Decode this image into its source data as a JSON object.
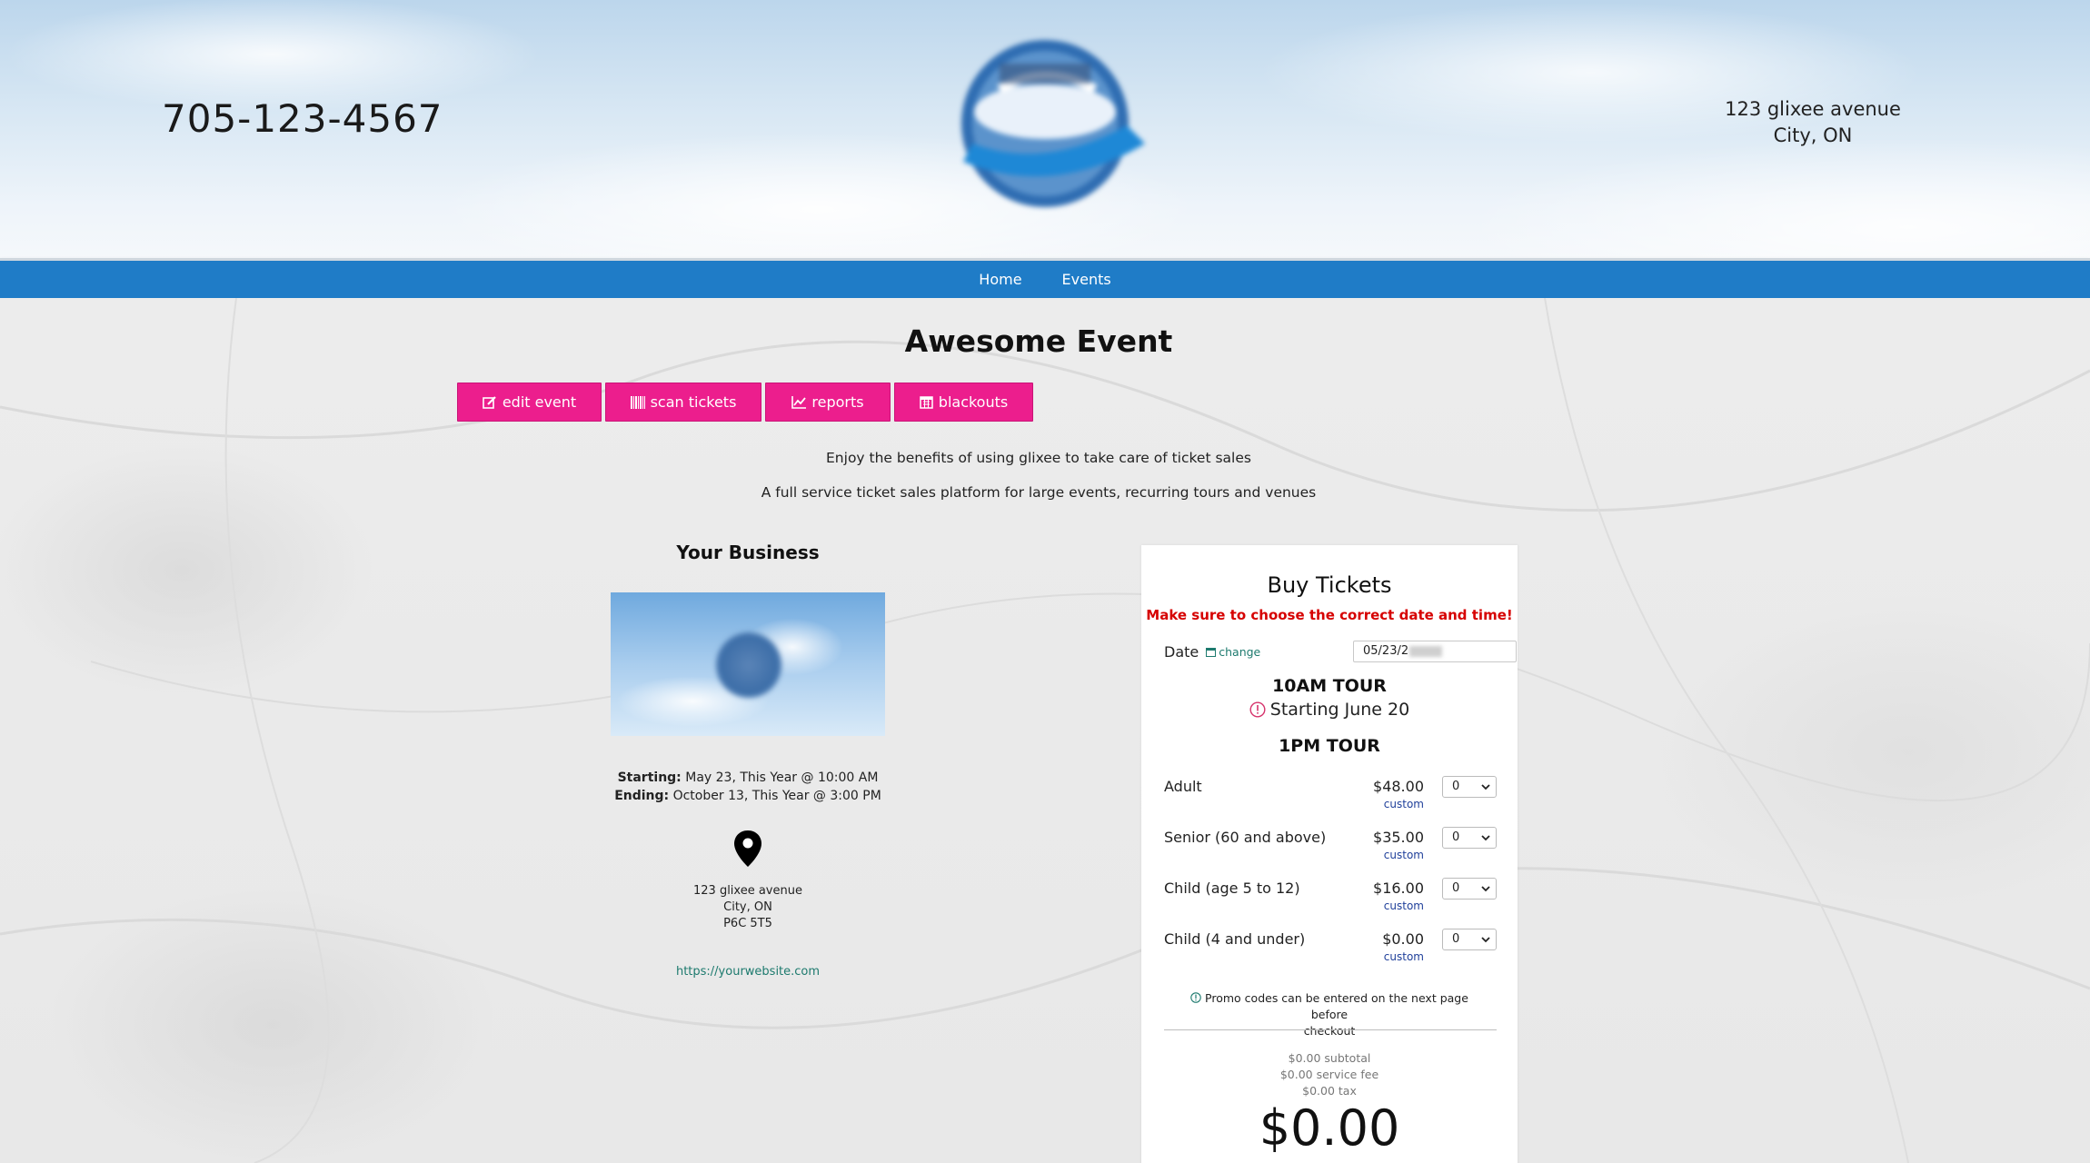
{
  "header": {
    "phone": "705-123-4567",
    "address_line1": "123 glixee avenue",
    "address_line2": "City, ON",
    "logo_icon": "company-logo"
  },
  "nav": {
    "items": [
      "Home",
      "Events"
    ]
  },
  "event": {
    "title": "Awesome Event",
    "buttons": [
      {
        "label": "edit event",
        "icon": "edit-icon"
      },
      {
        "label": "scan tickets",
        "icon": "barcode-icon"
      },
      {
        "label": "reports",
        "icon": "chart-icon"
      },
      {
        "label": "blackouts",
        "icon": "calendar-icon"
      }
    ],
    "description_line1": "Enjoy the benefits of using glixee to take care of ticket sales",
    "description_line2": "A full service ticket sales platform for large events, recurring tours and venues"
  },
  "business": {
    "title": "Your Business",
    "starting_label": "Starting:",
    "starting_value": "May 23, This Year @ 10:00 AM",
    "ending_label": "Ending:",
    "ending_value": "October 13, This Year @ 3:00 PM",
    "address_line1": "123 glixee avenue",
    "address_line2": "City, ON",
    "address_line3": "P6C 5T5",
    "website": "https://yourwebsite.com"
  },
  "tickets": {
    "title": "Buy Tickets",
    "warning": "Make sure to choose the correct date and time!",
    "date_label": "Date",
    "date_change": "change",
    "date_value": "05/23/2",
    "tour1_name": "10AM TOUR",
    "tour1_note": "Starting June 20",
    "tour2_name": "1PM TOUR",
    "types": [
      {
        "name": "Adult",
        "price": "$48.00",
        "custom": "custom",
        "qty": "0"
      },
      {
        "name": "Senior (60 and above)",
        "price": "$35.00",
        "custom": "custom",
        "qty": "0"
      },
      {
        "name": "Child (age 5 to 12)",
        "price": "$16.00",
        "custom": "custom",
        "qty": "0"
      },
      {
        "name": "Child (4 and under)",
        "price": "$0.00",
        "custom": "custom",
        "qty": "0"
      }
    ],
    "promo_line1": "Promo codes can be entered on the next page before",
    "promo_line2": "checkout",
    "subtotal": "$0.00 subtotal",
    "service_fee": "$0.00 service fee",
    "tax": "$0.00 tax",
    "total": "$0.00"
  },
  "colors": {
    "nav": "#1f7cc7",
    "button": "#ec1e8d",
    "warning": "#d60000",
    "link": "#1d7a6e"
  }
}
